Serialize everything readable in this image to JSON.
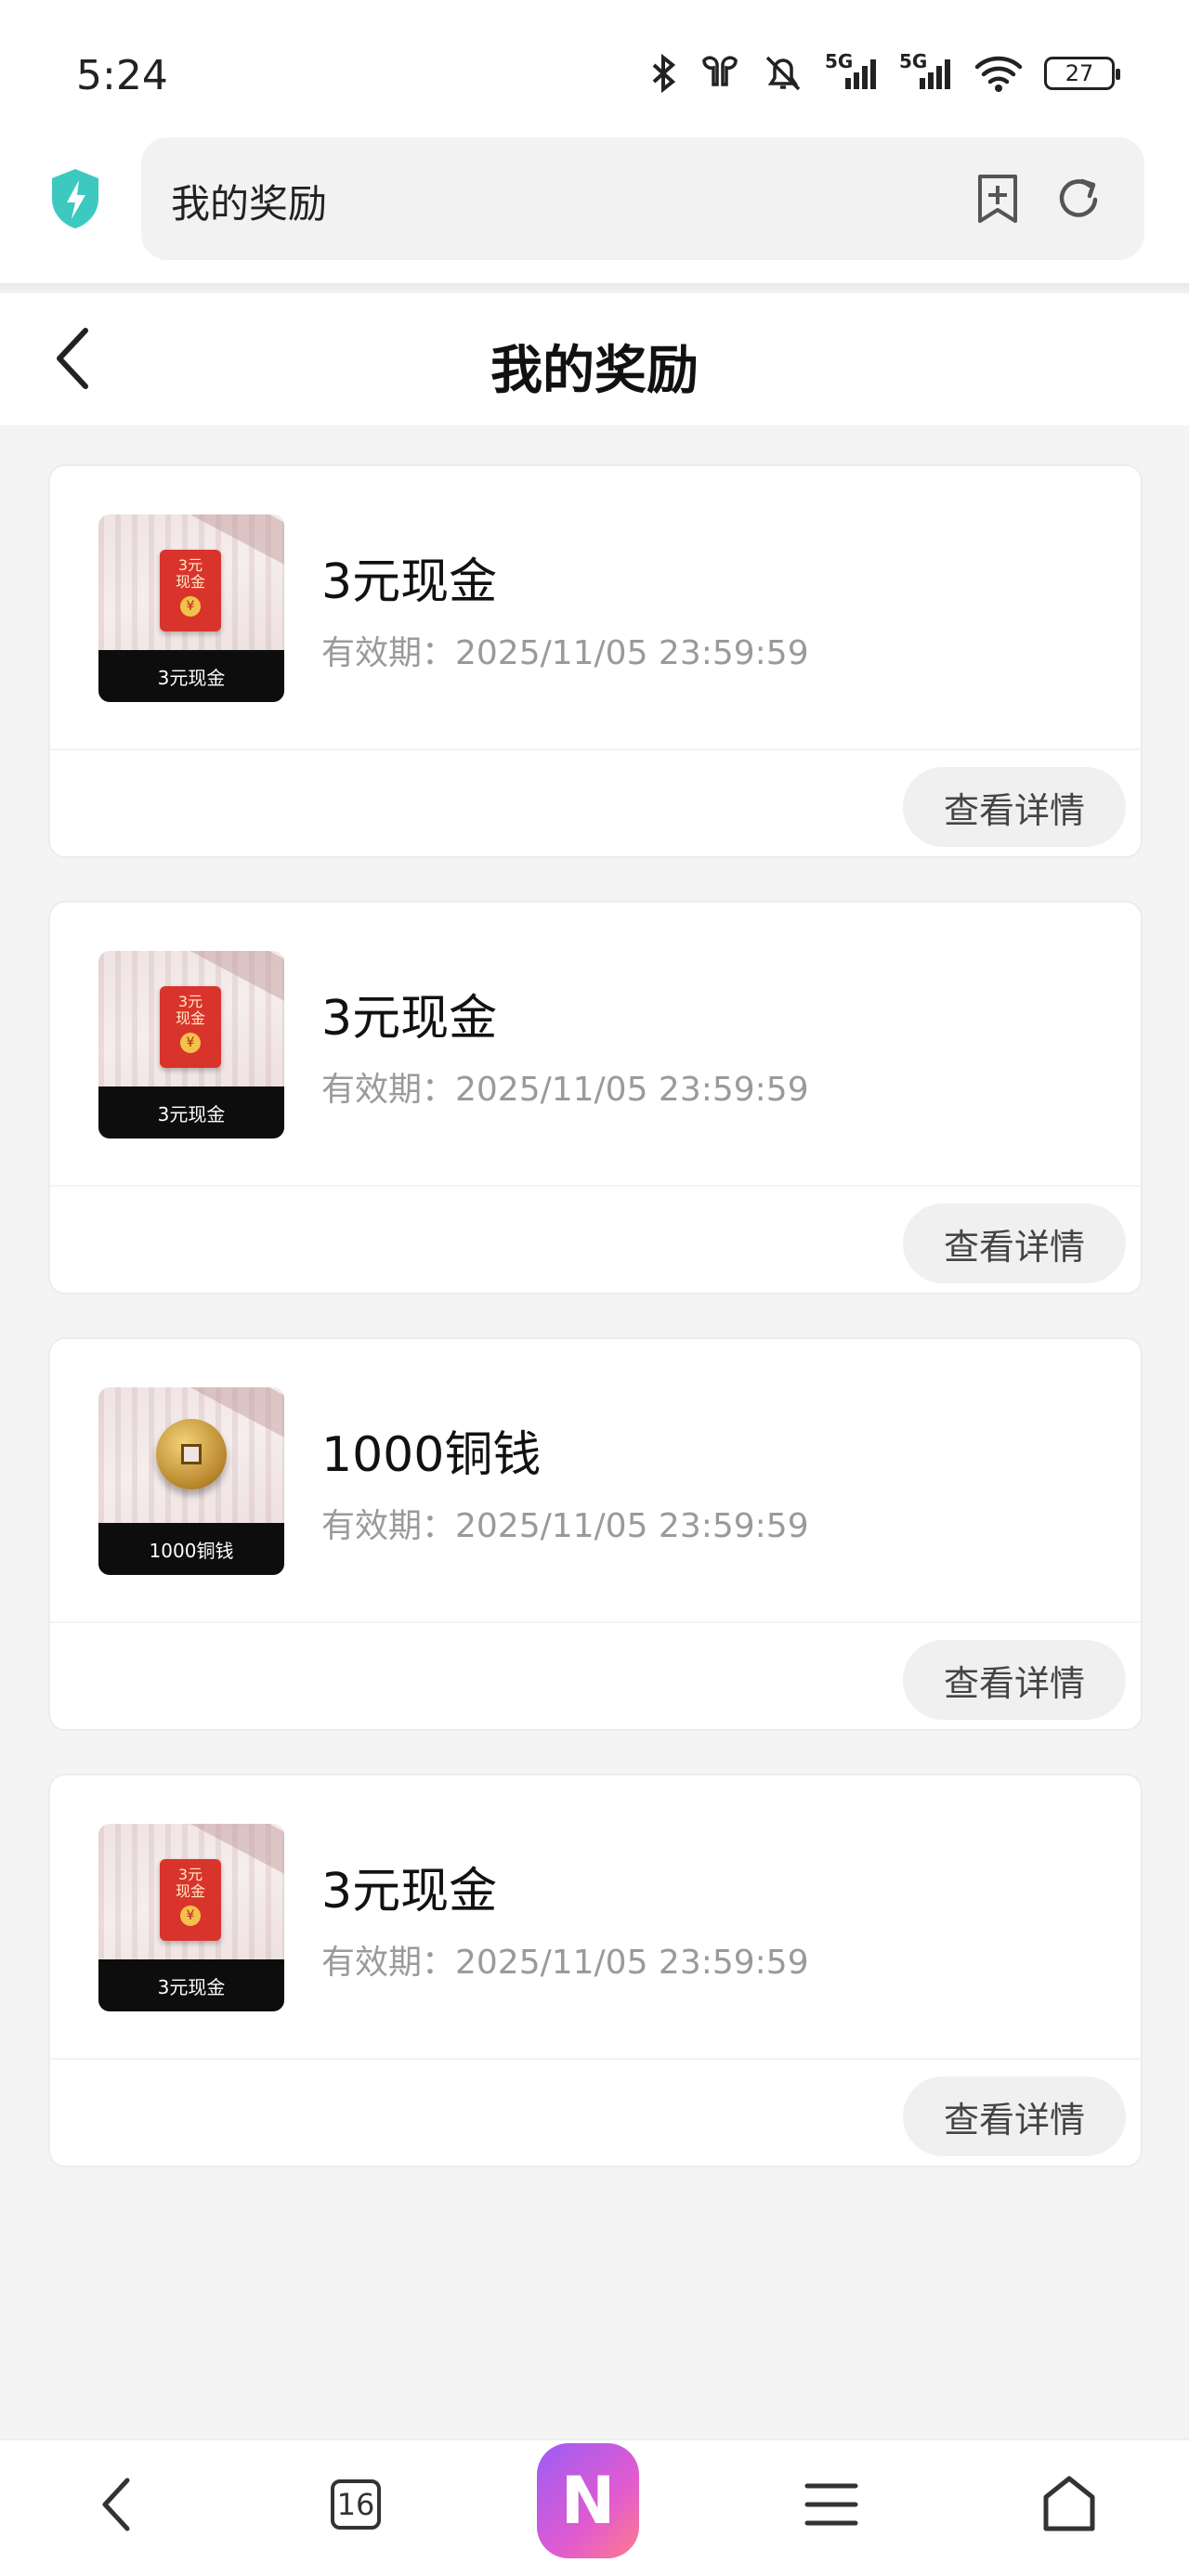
{
  "status_bar": {
    "time": "5:24",
    "network_label_1": "5G",
    "network_label_2": "5G",
    "battery": "27"
  },
  "browser": {
    "address_text": "我的奖励",
    "shield_color": "#3dc9c0"
  },
  "header": {
    "title": "我的奖励"
  },
  "rewards": [
    {
      "thumb_caption": "3元现金",
      "envelope_text": "3元\n现金",
      "name": "3元现金",
      "expiry": "有效期：2025/11/05 23:59:59",
      "button": "查看详情",
      "icon": "red-envelope-icon"
    },
    {
      "thumb_caption": "3元现金",
      "envelope_text": "3元\n现金",
      "name": "3元现金",
      "expiry": "有效期：2025/11/05 23:59:59",
      "button": "查看详情",
      "icon": "red-envelope-icon"
    },
    {
      "thumb_caption": "1000铜钱",
      "envelope_text": "",
      "name": "1000铜钱",
      "expiry": "有效期：2025/11/05 23:59:59",
      "button": "查看详情",
      "icon": "copper-coin-icon"
    },
    {
      "thumb_caption": "3元现金",
      "envelope_text": "3元\n现金",
      "name": "3元现金",
      "expiry": "有效期：2025/11/05 23:59:59",
      "button": "查看详情",
      "icon": "red-envelope-icon"
    }
  ],
  "bottom_nav": {
    "tab_count": "16",
    "ai_label": "N"
  }
}
